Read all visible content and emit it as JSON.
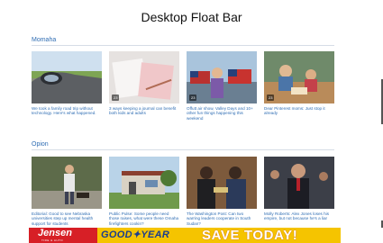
{
  "page": {
    "title": "Desktop Float Bar"
  },
  "sections": [
    {
      "label": "Momaha",
      "cards": [
        {
          "caption": "We took a family road trip without technology. Here's what happened.",
          "badge": ""
        },
        {
          "caption": "3 ways keeping a journal can benefit both kids and adults",
          "badge": "23"
        },
        {
          "caption": "Offutt air show, Valley Days and 10+ other fun things happening this weekend",
          "badge": "23"
        },
        {
          "caption": "Dear Pinterest moms: Just stop it already",
          "badge": "23"
        }
      ]
    },
    {
      "label": "Opion",
      "cards": [
        {
          "caption": "Editorial: Good to see Nebraska universities step up mental health support for students"
        },
        {
          "caption": "Public Pulse: Some people need those raises, what were these Omaha firefighters cookin?"
        },
        {
          "caption": "The Washington Post: Can two warring leaders cooperate in South Sudan?"
        },
        {
          "caption": "Molly Roberts: Alex Jones loses his empire, but not because he's a liar"
        }
      ]
    }
  ],
  "float_bar": {
    "brand_left": "Jensen",
    "brand_left_sub": "TIRE & AUTO",
    "brand_mid": "GOOD✦YEAR",
    "cta": "SAVE TODAY!",
    "colors": {
      "background": "#f5c400",
      "left_panel": "#d71f26",
      "mid_text": "#1a3d8f"
    }
  },
  "colors": {
    "link": "#2f6db3",
    "rule": "#d6dde6"
  },
  "icons": [
    "photo-gallery-icon"
  ]
}
